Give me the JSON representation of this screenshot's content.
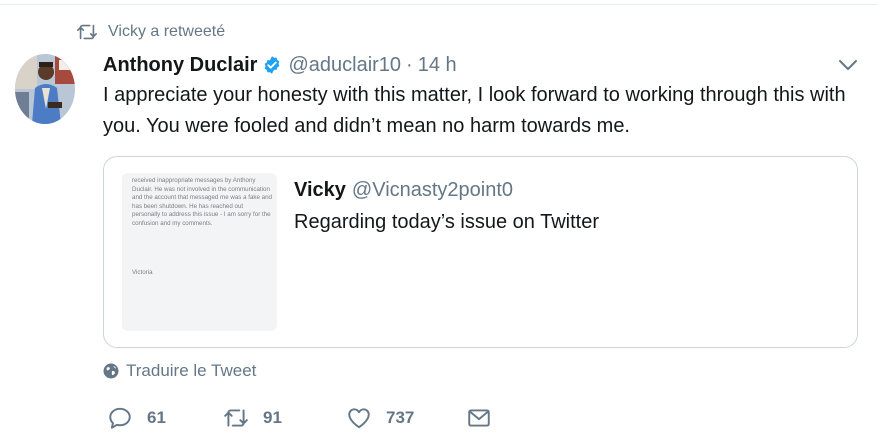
{
  "retweet_context": {
    "label": "Vicky a retweeté",
    "icon": "retweet-icon"
  },
  "tweet": {
    "author_name": "Anthony Duclair",
    "verified": true,
    "handle": "@aduclair10",
    "separator": "·",
    "time": "14 h",
    "text": "I appreciate your honesty with this matter, I look forward to working through this with you. You were fooled and didn’t mean no harm towards me."
  },
  "quoted_tweet": {
    "author_name": "Vicky",
    "handle": "@Vicnasty2point0",
    "text": "Regarding today’s issue on Twitter",
    "image_text": "received inappropriate messages by Anthony Duclair. He was not involved in the communication and the account that messaged me was a fake and has been shutdown. He has reached out personally to address this issue - I am sorry for the confusion and my comments.",
    "image_signature": "Victoria"
  },
  "translate": {
    "label": "Traduire le Tweet",
    "icon": "globe-icon"
  },
  "actions": {
    "reply_count": "61",
    "retweet_count": "91",
    "like_count": "737"
  },
  "colors": {
    "text": "#14171a",
    "secondary": "#657786",
    "verified": "#1da1f2",
    "border": "#ccd6dd"
  }
}
